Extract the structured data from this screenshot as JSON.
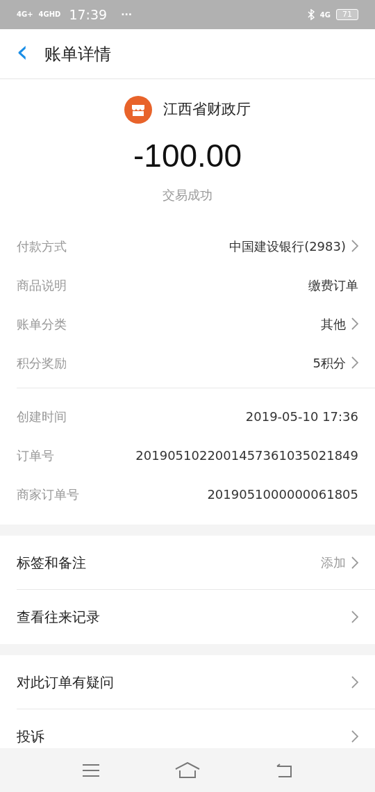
{
  "status_bar": {
    "sim1": "4G+",
    "sim2": "4GHD",
    "time": "17:39",
    "more": "···",
    "network": "4G",
    "battery": "71"
  },
  "header": {
    "back": "‹",
    "title": "账单详情"
  },
  "merchant": {
    "name": "江西省财政厅"
  },
  "amount": "-100.00",
  "result": "交易成功",
  "details": [
    {
      "label": "付款方式",
      "value": "中国建设银行(2983)",
      "chevron": true
    },
    {
      "label": "商品说明",
      "value": "缴费订单",
      "chevron": false
    },
    {
      "label": "账单分类",
      "value": "其他",
      "chevron": true
    },
    {
      "label": "积分奖励",
      "value": "5积分",
      "chevron": true
    }
  ],
  "order_info": [
    {
      "label": "创建时间",
      "value": "2019-05-10 17:36"
    },
    {
      "label": "订单号",
      "value": "2019051022001457361035021849"
    },
    {
      "label": "商家订单号",
      "value": "2019051000000061805"
    }
  ],
  "action_groups": [
    [
      {
        "label": "标签和备注",
        "value": "添加"
      },
      {
        "label": "查看往来记录"
      }
    ],
    [
      {
        "label": "对此订单有疑问"
      },
      {
        "label": "投诉"
      }
    ]
  ]
}
